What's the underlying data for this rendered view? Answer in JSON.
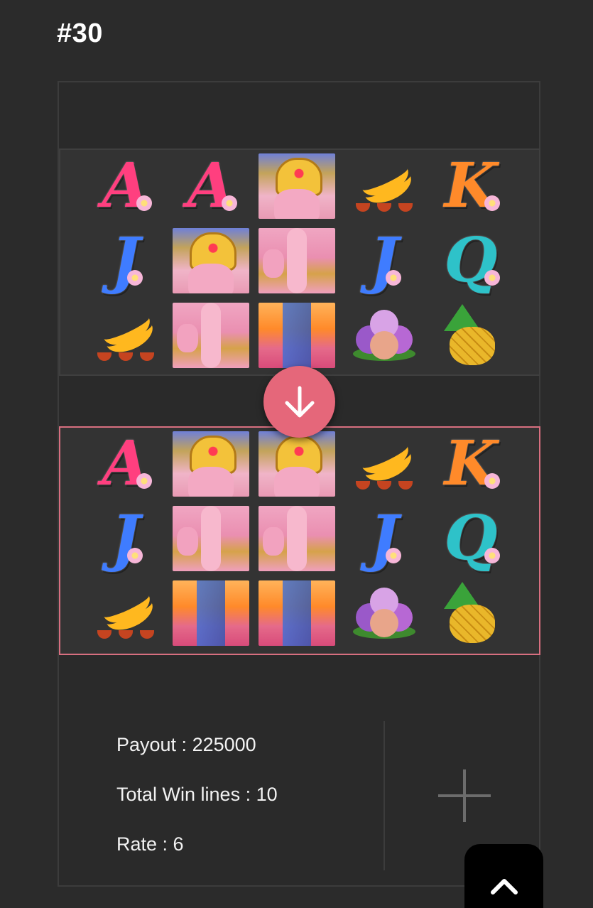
{
  "header": {
    "title": "#30"
  },
  "grid_before": {
    "rows": [
      [
        "A",
        "A",
        "ganesh-top",
        "banana",
        "K"
      ],
      [
        "J",
        "ganesh-top",
        "ganesh-mid",
        "J",
        "Q"
      ],
      [
        "banana",
        "ganesh-mid",
        "ganesh-bot",
        "icecream",
        "pineapple"
      ]
    ]
  },
  "grid_after": {
    "rows": [
      [
        "A",
        "ganesh-top",
        "ganesh-top",
        "banana",
        "K"
      ],
      [
        "J",
        "ganesh-mid",
        "ganesh-mid",
        "J",
        "Q"
      ],
      [
        "banana",
        "ganesh-bot",
        "ganesh-bot",
        "icecream",
        "pineapple"
      ]
    ]
  },
  "symbol_colors": {
    "A": "#ff3f7f",
    "K": "#ff8a2a",
    "J": "#3f7cff",
    "Q": "#2ec2c9"
  },
  "arrow_button": {
    "icon": "arrow-down-icon",
    "color": "#e5677a"
  },
  "info": {
    "payout": "Payout : 225000",
    "win_lines": "Total Win lines : 10",
    "rate": "Rate : 6"
  },
  "expand_button": {
    "icon": "plus-icon"
  },
  "scroll_top_button": {
    "icon": "chevron-up-icon"
  }
}
